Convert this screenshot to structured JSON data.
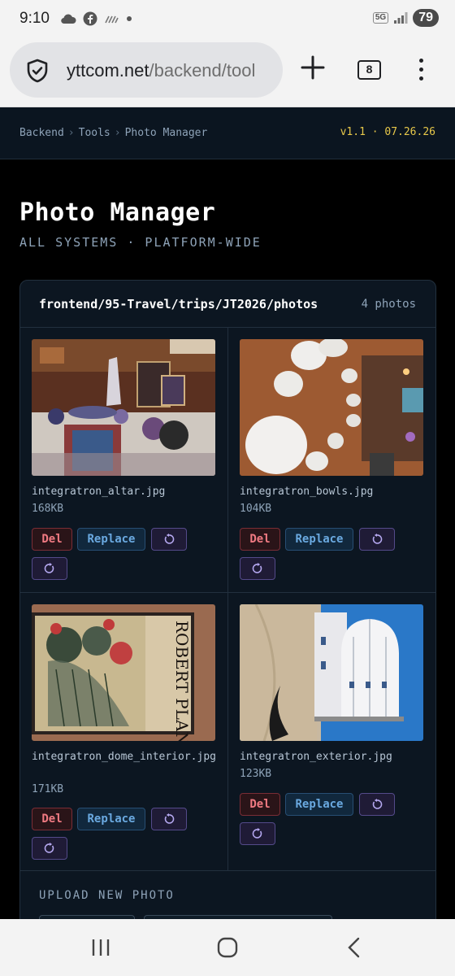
{
  "status_bar": {
    "time": "9:10",
    "network": "5G",
    "battery": "79",
    "icons": [
      "cloud-icon",
      "facebook-icon",
      "signal-off-icon",
      "dot-icon",
      "signal-icon"
    ]
  },
  "browser": {
    "url_host": "yttcom.net",
    "url_path": "/backend/tool",
    "tab_count": "8"
  },
  "header": {
    "breadcrumb": [
      "Backend",
      "Tools",
      "Photo Manager"
    ],
    "breadcrumb_sep": "›",
    "version": "v1.1 · 07.26.26"
  },
  "page": {
    "title": "Photo Manager",
    "subtitle": "ALL SYSTEMS · PLATFORM-WIDE"
  },
  "panel": {
    "path": "frontend/95-Travel/trips/JT2026/photos",
    "count": "4 photos",
    "photos": [
      {
        "filename": "integratron_altar.jpg",
        "size": "168KB"
      },
      {
        "filename": "integratron_bowls.jpg",
        "size": "104KB"
      },
      {
        "filename": "integratron_dome_interior.jpg",
        "size": "171KB"
      },
      {
        "filename": "integratron_exterior.jpg",
        "size": "123KB"
      }
    ],
    "actions": {
      "delete": "Del",
      "replace": "Replace"
    },
    "upload_label": "UPLOAD NEW PHOTO"
  },
  "colors": {
    "accent_yellow": "#e7c84a",
    "danger": "#f07a82",
    "info": "#6aa9e0",
    "rotate": "#b5a8f0"
  }
}
